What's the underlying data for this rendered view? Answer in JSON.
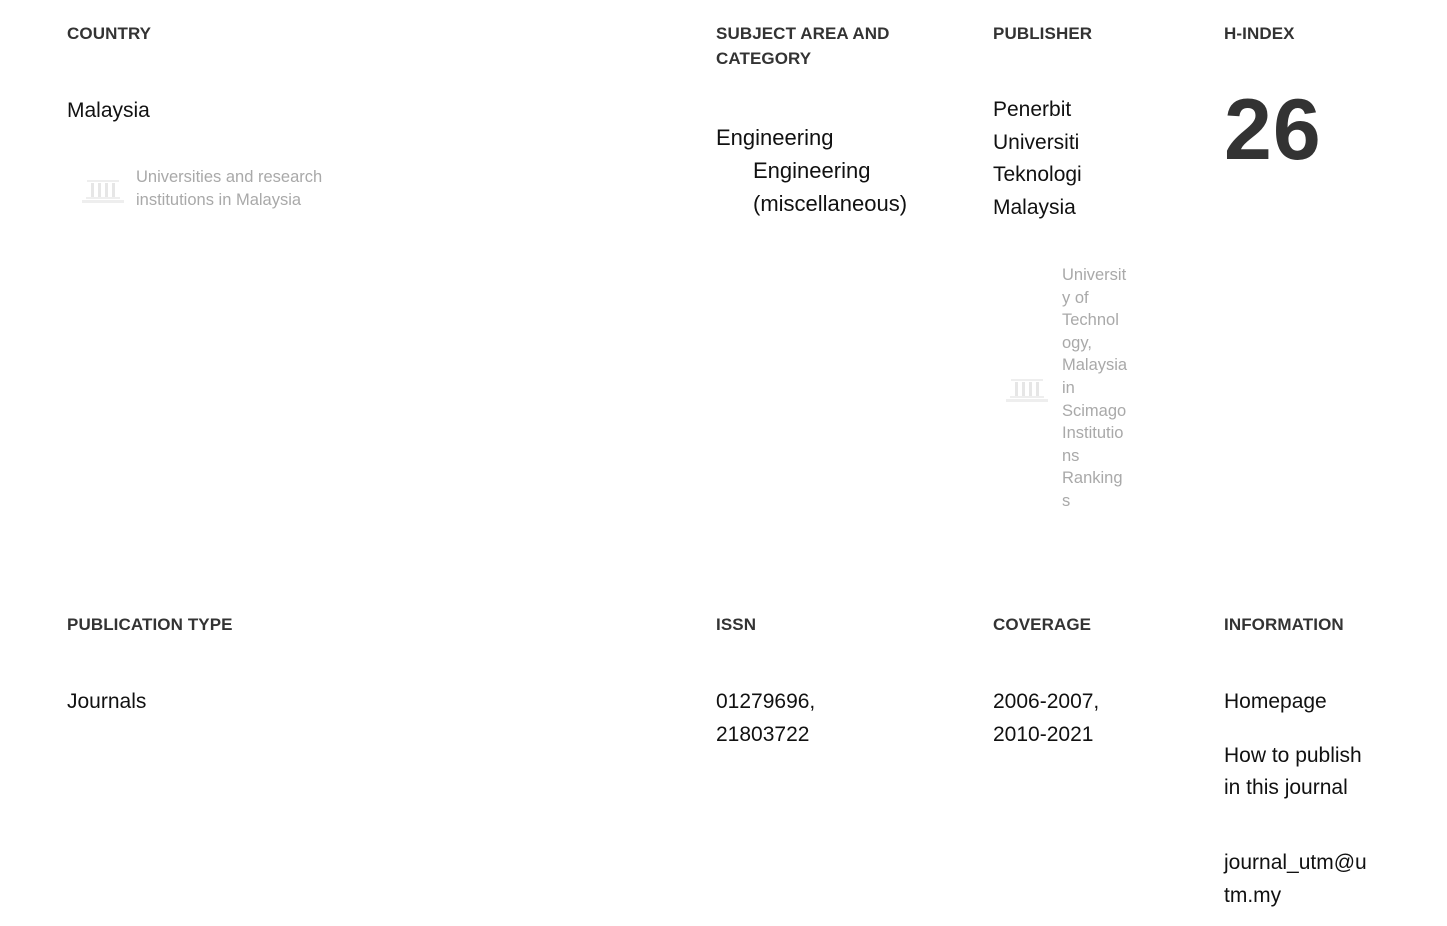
{
  "country": {
    "heading": "COUNTRY",
    "name": "Malaysia",
    "institutions_link": "Universities and research institutions in Malaysia"
  },
  "subject": {
    "heading_line1": "SUBJECT AREA AND",
    "heading_line2": "CATEGORY",
    "area": "Engineering",
    "category_line1": "Engineering",
    "category_line2": "(miscellaneous)"
  },
  "publisher": {
    "heading": "PUBLISHER",
    "name_lines": [
      "Penerbit",
      "Universiti",
      "Teknologi",
      "Malaysia"
    ],
    "ranking_link_lines": [
      "Universit",
      "y of",
      "Technol",
      "ogy,",
      "Malaysia",
      "in",
      "Scimago",
      "Institutio",
      "ns",
      "Ranking",
      "s"
    ]
  },
  "hindex": {
    "heading": "H-INDEX",
    "value": "26"
  },
  "publication_type": {
    "heading": "PUBLICATION TYPE",
    "value": "Journals"
  },
  "issn": {
    "heading": "ISSN",
    "line1": "01279696,",
    "line2": "21803722"
  },
  "coverage": {
    "heading": "COVERAGE",
    "line1": "2006-2007,",
    "line2": "2010-2021"
  },
  "information": {
    "heading": "INFORMATION",
    "homepage": "Homepage",
    "how_to_publish_line1": "How to publish",
    "how_to_publish_line2": "in this journal",
    "email_line1": "journal_utm@u",
    "email_line2": "tm.my"
  },
  "colors": {
    "link": "#0277bd",
    "heading": "#333333",
    "muted": "#a9a9a9"
  },
  "icons": {
    "institution": "institution-building-icon"
  }
}
